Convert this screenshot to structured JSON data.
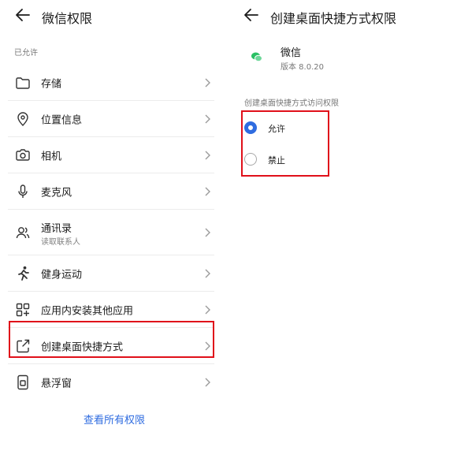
{
  "left_panel": {
    "title": "微信权限",
    "section_label": "已允许",
    "items": [
      {
        "label": "存储",
        "icon": "folder-icon"
      },
      {
        "label": "位置信息",
        "icon": "location-pin-icon"
      },
      {
        "label": "相机",
        "icon": "camera-icon"
      },
      {
        "label": "麦克风",
        "icon": "microphone-icon"
      },
      {
        "label": "通讯录",
        "sublabel": "读取联系人",
        "icon": "contacts-icon"
      },
      {
        "label": "健身运动",
        "icon": "running-icon"
      },
      {
        "label": "应用内安装其他应用",
        "icon": "apps-grid-icon"
      },
      {
        "label": "创建桌面快捷方式",
        "icon": "share-shortcut-icon"
      },
      {
        "label": "悬浮窗",
        "icon": "floating-window-icon"
      }
    ],
    "view_all": "查看所有权限"
  },
  "right_panel": {
    "title": "创建桌面快捷方式权限",
    "app_name": "微信",
    "app_version": "版本 8.0.20",
    "permission_label": "创建桌面快捷方式访问权限",
    "options": [
      {
        "label": "允许",
        "selected": true
      },
      {
        "label": "禁止",
        "selected": false
      }
    ]
  },
  "colors": {
    "accent": "#2f6ce0",
    "highlight_box": "#e0101a",
    "wechat_green": "#2ac064"
  }
}
